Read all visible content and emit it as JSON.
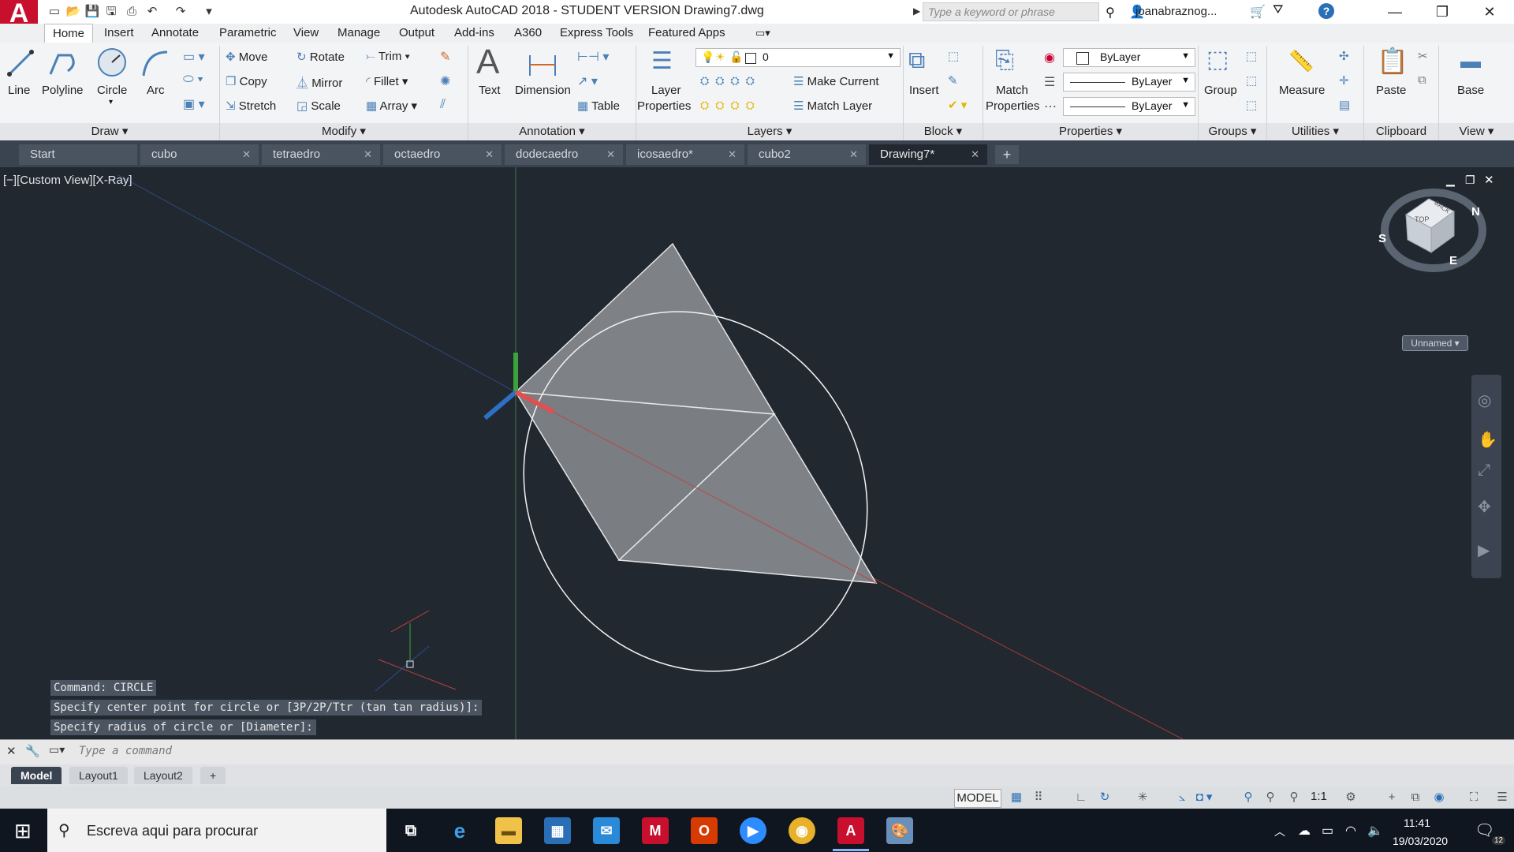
{
  "window": {
    "title": "Autodesk AutoCAD 2018 - STUDENT VERSION    Drawing7.dwg",
    "search_placeholder": "Type a keyword or phrase",
    "user": "joanabraznog...",
    "app_letter": "A"
  },
  "menu_tabs": [
    "Home",
    "Insert",
    "Annotate",
    "Parametric",
    "View",
    "Manage",
    "Output",
    "Add-ins",
    "A360",
    "Express Tools",
    "Featured Apps"
  ],
  "ribbon": {
    "draw": {
      "line": "Line",
      "polyline": "Polyline",
      "circle": "Circle",
      "arc": "Arc",
      "title": "Draw"
    },
    "modify": {
      "move": "Move",
      "copy": "Copy",
      "stretch": "Stretch",
      "rotate": "Rotate",
      "mirror": "Mirror",
      "scale": "Scale",
      "trim": "Trim",
      "fillet": "Fillet",
      "array": "Array",
      "title": "Modify"
    },
    "annotation": {
      "text": "Text",
      "dimension": "Dimension",
      "table": "Table",
      "title": "Annotation"
    },
    "layers": {
      "layer_properties_1": "Layer",
      "layer_properties_2": "Properties",
      "layer_value": "0",
      "make_current": "Make Current",
      "match_layer": "Match Layer",
      "title": "Layers"
    },
    "block": {
      "insert": "Insert",
      "title": "Block"
    },
    "properties": {
      "match_1": "Match",
      "match_2": "Properties",
      "color": "ByLayer",
      "linetype": "ByLayer",
      "lineweight": "ByLayer",
      "title": "Properties"
    },
    "groups": {
      "group": "Group",
      "title": "Groups"
    },
    "utilities": {
      "measure": "Measure",
      "title": "Utilities"
    },
    "clipboard": {
      "paste": "Paste",
      "title": "Clipboard"
    },
    "view": {
      "base": "Base",
      "title": "View"
    }
  },
  "doc_tabs": [
    "Start",
    "cubo",
    "tetraedro",
    "octaedro",
    "dodecaedro",
    "icosaedro*",
    "cubo2",
    "Drawing7*"
  ],
  "viewport": {
    "label": "[−][Custom View][X-Ray]",
    "viewcube_top": "TOP",
    "viewcube_back": "BACK",
    "compass_n": "N",
    "compass_s": "S",
    "compass_e": "E",
    "ucs_name": "Unnamed"
  },
  "command_history": [
    "Command: CIRCLE",
    "Specify center point for circle or [3P/2P/Ttr (tan tan radius)]:",
    "Specify radius of circle or [Diameter]:"
  ],
  "command_placeholder": "Type a command",
  "layout_tabs": [
    "Model",
    "Layout1",
    "Layout2"
  ],
  "status": {
    "model": "MODEL",
    "scale": "1:1"
  },
  "taskbar": {
    "search_text": "Escreva aqui para procurar",
    "time": "11:41",
    "date": "19/03/2020",
    "notifications": "12"
  },
  "colors": {
    "accent": "#c8102e",
    "canvas": "#212830",
    "ribbon": "#f3f4f5"
  }
}
